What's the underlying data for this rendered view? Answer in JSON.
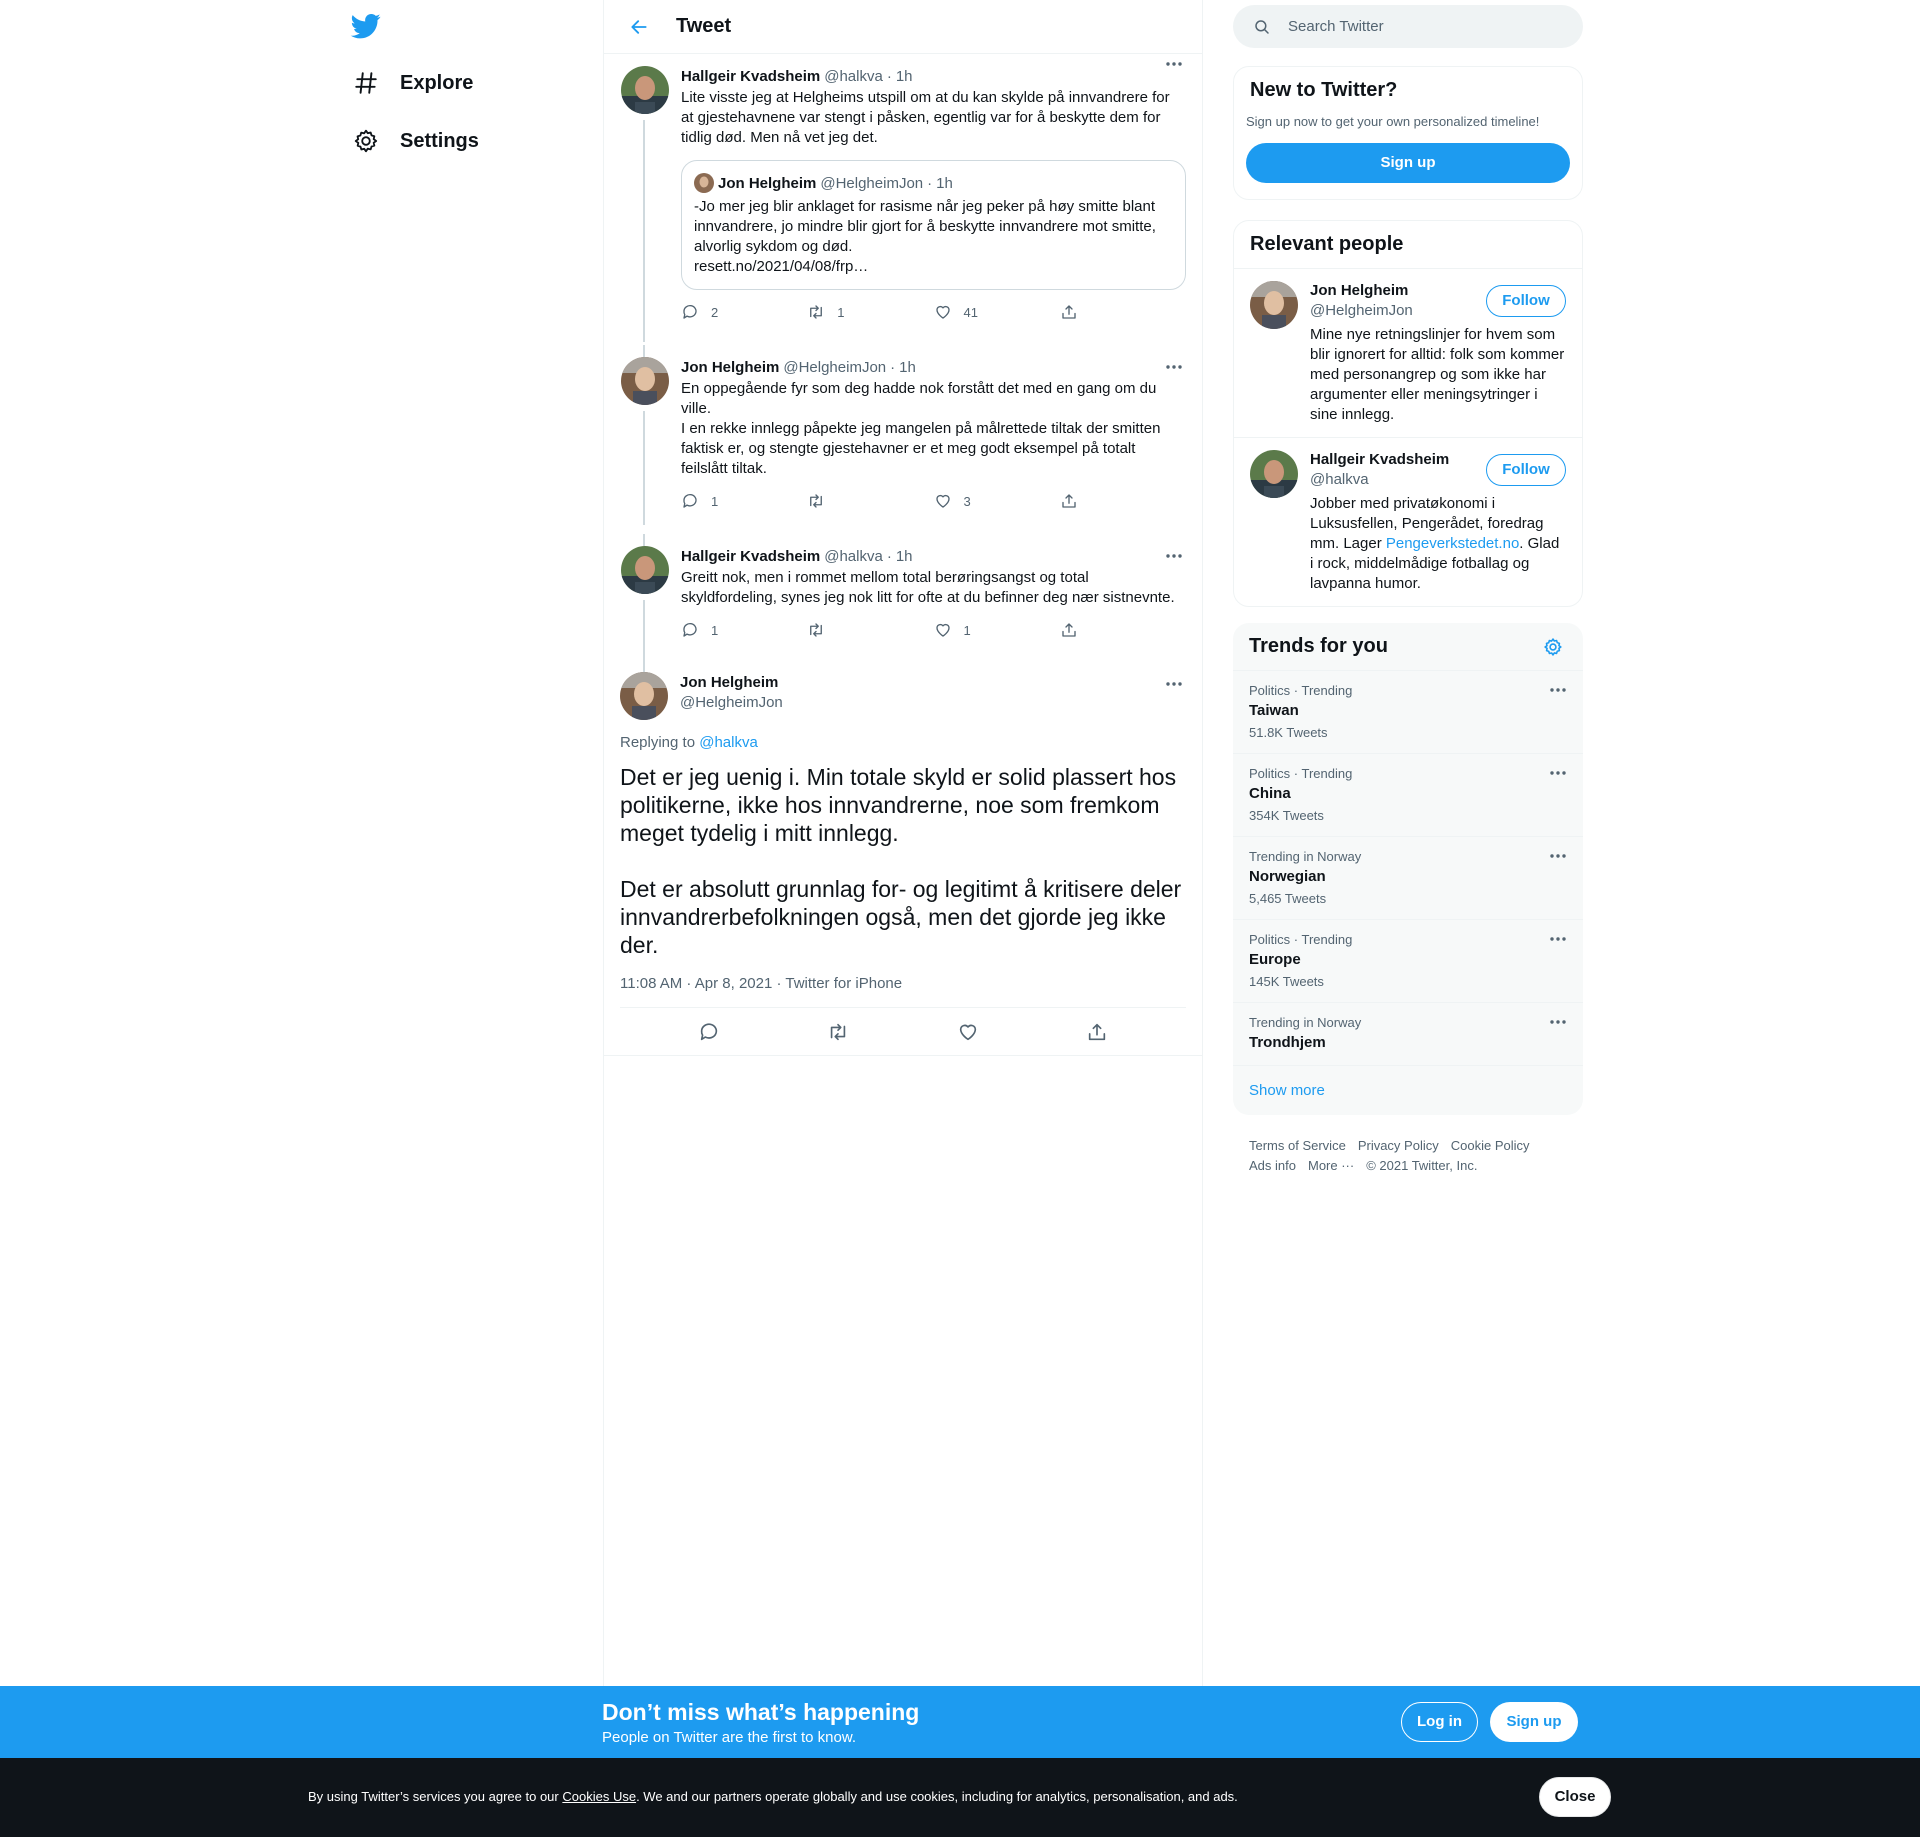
{
  "nav": {
    "explore_label": "Explore",
    "settings_label": "Settings"
  },
  "header": {
    "title": "Tweet"
  },
  "thread": [
    {
      "name": "Hallgeir Kvadsheim",
      "handle": "@halkva",
      "time": "1h",
      "text": "Lite visste jeg at Helgheims utspill om at du kan skylde på innvandrere for at gjestehavnene var stengt i påsken, egentlig var for å beskytte dem for tidlig død. Men nå vet jeg det.",
      "quote": {
        "name": "Jon Helgheim",
        "handle": "@HelgheimJon",
        "time": "1h",
        "text": "-Jo mer jeg blir anklaget for rasisme når jeg peker på høy smitte blant innvandrere, jo mindre blir gjort for å beskytte innvandrere mot smitte, alvorlig sykdom og død.",
        "link": "resett.no/2021/04/08/frp…"
      },
      "replies": "2",
      "retweets": "1",
      "likes": "41"
    },
    {
      "name": "Jon Helgheim",
      "handle": "@HelgheimJon",
      "time": "1h",
      "text": "En oppegående fyr som deg hadde nok forstått det med en gang om du ville.\nI en rekke innlegg påpekte jeg mangelen på målrettede tiltak der smitten faktisk er, og stengte gjestehavner er et meg godt eksempel på totalt feilslått tiltak.",
      "replies": "1",
      "retweets": "",
      "likes": "3"
    },
    {
      "name": "Hallgeir Kvadsheim",
      "handle": "@halkva",
      "time": "1h",
      "text": "Greitt nok, men i rommet mellom total berøringsangst og total skyldfordeling, synes jeg nok litt for ofte at du befinner deg nær sistnevnte.",
      "replies": "1",
      "retweets": "",
      "likes": "1"
    }
  ],
  "main_tweet": {
    "name": "Jon Helgheim",
    "handle": "@HelgheimJon",
    "replying_prefix": "Replying to",
    "replying_to": "@halkva",
    "text": "Det er jeg uenig i. Min totale skyld er solid plassert hos politikerne, ikke hos innvandrerne, noe som fremkom meget tydelig i mitt innlegg.\n\nDet er absolutt grunnlag for- og legitimt å kritisere deler innvandrerbefolkningen også, men det gjorde jeg ikke der.",
    "meta": "11:08 AM · Apr 8, 2021 · Twitter for iPhone"
  },
  "search": {
    "placeholder": "Search Twitter"
  },
  "new_to_twitter": {
    "title": "New to Twitter?",
    "subtitle": "Sign up now to get your own personalized timeline!",
    "signup_label": "Sign up"
  },
  "relevant_people": {
    "title": "Relevant people",
    "follow_label": "Follow",
    "people": [
      {
        "name": "Jon Helgheim",
        "handle": "@HelgheimJon",
        "bio": "Mine nye retningslinjer for hvem som blir ignorert for alltid: folk som kommer med personangrep og som ikke har argumenter eller meningsytringer i sine innlegg."
      },
      {
        "name": "Hallgeir Kvadsheim",
        "handle": "@halkva",
        "bio_before": "Jobber med privatøkonomi i Luksusfellen, Pengerådet, foredrag mm. Lager ",
        "bio_link": "Pengeverkstedet.no",
        "bio_after": ". Glad i rock, middelmådige fotballag og lavpanna humor."
      }
    ]
  },
  "trends": {
    "title": "Trends for you",
    "items": [
      {
        "context": "Politics · Trending",
        "name": "Taiwan",
        "count": "51.8K Tweets"
      },
      {
        "context": "Politics · Trending",
        "name": "China",
        "count": "354K Tweets"
      },
      {
        "context": "Trending in Norway",
        "name": "Norwegian",
        "count": "5,465 Tweets"
      },
      {
        "context": "Politics · Trending",
        "name": "Europe",
        "count": "145K Tweets"
      },
      {
        "context": "Trending in Norway",
        "name": "Trondhjem",
        "count": ""
      }
    ],
    "show_more": "Show more"
  },
  "footer": {
    "terms": "Terms of Service",
    "privacy": "Privacy Policy",
    "cookie": "Cookie Policy",
    "ads": "Ads info",
    "more": "More ···",
    "copyright": "© 2021 Twitter, Inc."
  },
  "bottom_bar": {
    "title": "Don’t miss what’s happening",
    "subtitle": "People on Twitter are the first to know.",
    "login_label": "Log in",
    "signup_label": "Sign up"
  },
  "cookie_bar": {
    "text_before": "By using Twitter’s services you agree to our ",
    "link": "Cookies Use",
    "text_after": ". We and our partners operate globally and use cookies, including for analytics, personalisation, and ads.",
    "close_label": "Close"
  },
  "colors": {
    "accent": "#1d9bf0",
    "text": "#0f1419",
    "secondary": "#536471"
  }
}
